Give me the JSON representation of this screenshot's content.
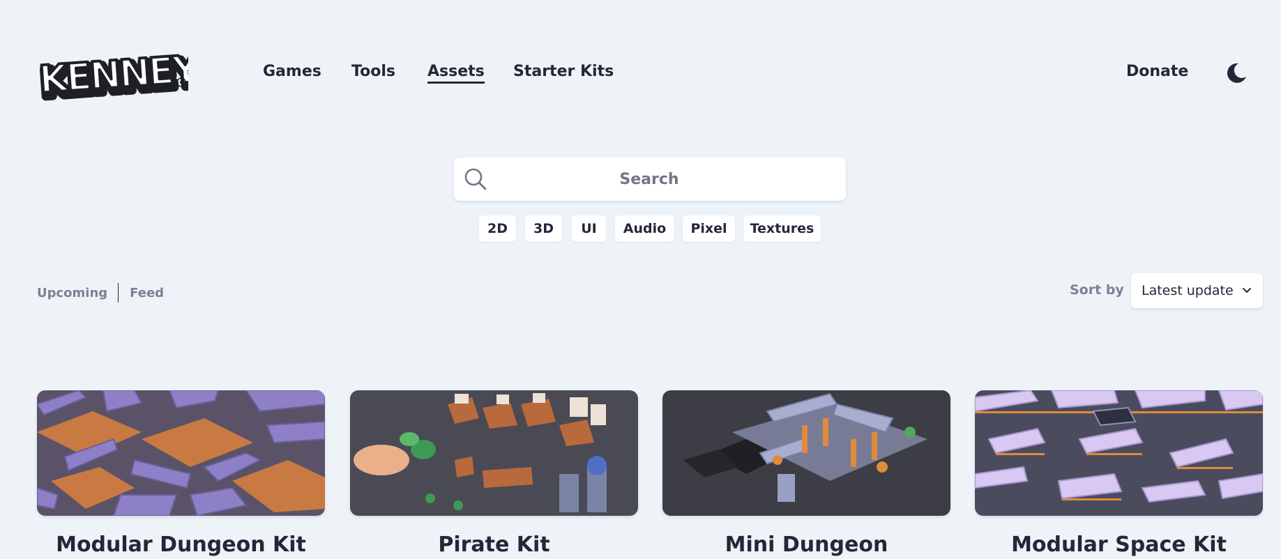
{
  "brand": {
    "logo_text": "KENNEY"
  },
  "nav": {
    "items": [
      {
        "label": "Games",
        "active": false
      },
      {
        "label": "Tools",
        "active": false
      },
      {
        "label": "Assets",
        "active": true
      },
      {
        "label": "Starter Kits",
        "active": false
      }
    ],
    "donate_label": "Donate",
    "theme_icon": "moon-icon"
  },
  "search": {
    "placeholder": "Search",
    "value": "",
    "icon": "search-icon"
  },
  "tags": [
    "2D",
    "3D",
    "UI",
    "Audio",
    "Pixel",
    "Textures"
  ],
  "filters": {
    "upcoming_label": "Upcoming",
    "feed_label": "Feed"
  },
  "sort": {
    "label": "Sort by",
    "selected": "Latest update",
    "icon": "chevron-down-icon"
  },
  "cards": [
    {
      "title": "Modular Dungeon Kit",
      "palette": {
        "bg": "#7c6fae",
        "floor": "#c97a43"
      }
    },
    {
      "title": "Pirate Kit",
      "palette": {
        "bg": "#4a4a55",
        "accent": "#b86a3c"
      }
    },
    {
      "title": "Mini Dungeon",
      "palette": {
        "bg": "#3d3d45",
        "accent": "#8a8fb6"
      }
    },
    {
      "title": "Modular Space Kit",
      "palette": {
        "bg": "#c9b5e8",
        "accent": "#e08a3a"
      }
    }
  ]
}
